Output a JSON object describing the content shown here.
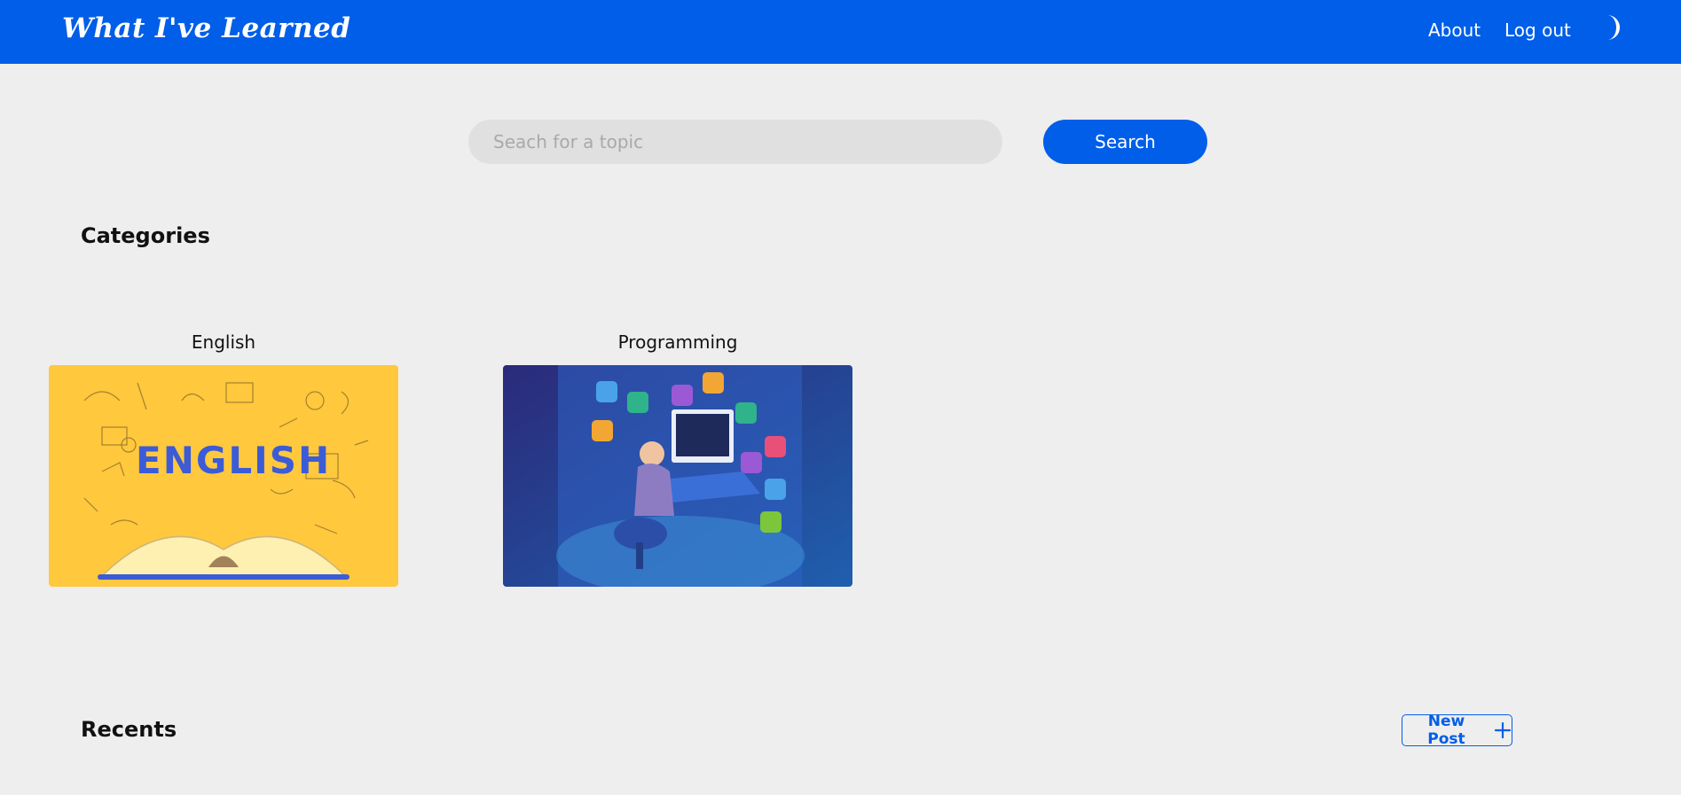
{
  "app": {
    "title": "What I've Learned",
    "accent": "#005ee8",
    "background": "#eeeeee"
  },
  "nav": {
    "about": "About",
    "logout": "Log out",
    "theme_icon": "moon-icon"
  },
  "search": {
    "placeholder": "Seach for a topic",
    "value": "",
    "button_label": "Search"
  },
  "categories": {
    "title": "Categories",
    "items": [
      {
        "label": "English",
        "image": "english-book-illustration"
      },
      {
        "label": "Programming",
        "image": "programmer-at-desk-illustration"
      }
    ]
  },
  "recents": {
    "title": "Recents",
    "new_post_label": "New Post",
    "new_post_icon": "plus-icon"
  }
}
